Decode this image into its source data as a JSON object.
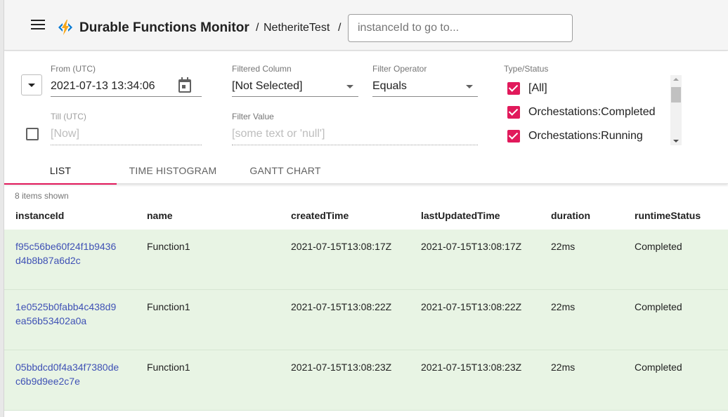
{
  "header": {
    "app_title": "Durable Functions Monitor",
    "task_hub": "NetheriteTest",
    "separator": "/",
    "goto_placeholder": "instanceId to go to..."
  },
  "filters": {
    "from_label": "From (UTC)",
    "from_value": "2021-07-13 13:34:06",
    "till_label": "Till (UTC)",
    "till_placeholder": "[Now]",
    "filtered_column_label": "Filtered Column",
    "filtered_column_value": "[Not Selected]",
    "filter_operator_label": "Filter Operator",
    "filter_operator_value": "Equals",
    "filter_value_label": "Filter Value",
    "filter_value_placeholder": "[some text or 'null']",
    "type_status_label": "Type/Status",
    "type_status_items": [
      {
        "label": "[All]",
        "checked": true
      },
      {
        "label": "Orchestations:Completed",
        "checked": true
      },
      {
        "label": "Orchestations:Running",
        "checked": true
      }
    ]
  },
  "tabs": [
    {
      "label": "LIST",
      "active": true
    },
    {
      "label": "TIME HISTOGRAM",
      "active": false
    },
    {
      "label": "GANTT CHART",
      "active": false
    }
  ],
  "list": {
    "items_shown": "8 items shown",
    "columns": [
      "instanceId",
      "name",
      "createdTime",
      "lastUpdatedTime",
      "duration",
      "runtimeStatus"
    ],
    "rows": [
      {
        "instanceId": "f95c56be60f24f1b9436d4b8b87a6d2c",
        "name": "Function1",
        "createdTime": "2021-07-15T13:08:17Z",
        "lastUpdatedTime": "2021-07-15T13:08:17Z",
        "duration": "22ms",
        "runtimeStatus": "Completed"
      },
      {
        "instanceId": "1e0525b0fabb4c438d9ea56b53402a0a",
        "name": "Function1",
        "createdTime": "2021-07-15T13:08:22Z",
        "lastUpdatedTime": "2021-07-15T13:08:22Z",
        "duration": "22ms",
        "runtimeStatus": "Completed"
      },
      {
        "instanceId": "05bbdcd0f4a34f7380dec6b9d9ee2c7e",
        "name": "Function1",
        "createdTime": "2021-07-15T13:08:23Z",
        "lastUpdatedTime": "2021-07-15T13:08:23Z",
        "duration": "22ms",
        "runtimeStatus": "Completed"
      }
    ]
  },
  "colors": {
    "accent": "#e1195b",
    "link": "#3f51b5",
    "row_background": "#e8f4e4"
  }
}
